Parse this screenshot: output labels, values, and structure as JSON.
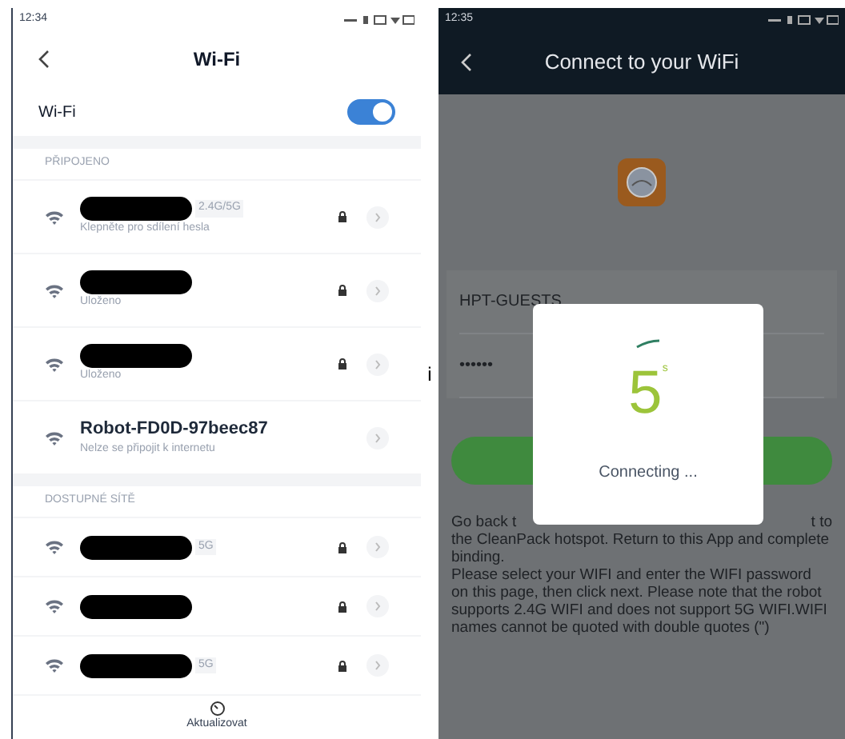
{
  "left_phone": {
    "status_bar": {
      "time": "12:34"
    },
    "title": "Wi-Fi",
    "wifi_toggle": {
      "label": "Wi-Fi",
      "on": true
    },
    "sections": [
      {
        "label": "PŘIPOJENO",
        "networks": [
          {
            "tag": "2.4G/5G",
            "subtitle": "Klepněte pro sdílení hesla",
            "redacted": true,
            "locked": true
          },
          {
            "subtitle": "Uloženo",
            "redacted": true,
            "locked": true
          },
          {
            "subtitle": "Uloženo",
            "redacted": true,
            "locked": true
          },
          {
            "name": "Robot-FD0D-97beec87",
            "subtitle": "Nelze se připojit k internetu",
            "redacted": false,
            "locked": false
          }
        ]
      },
      {
        "label": "DOSTUPNÉ SÍTĚ",
        "networks": [
          {
            "tag": "5G",
            "redacted": true,
            "locked": true
          },
          {
            "redacted": true,
            "locked": true
          },
          {
            "tag": "5G",
            "redacted": true,
            "locked": true
          }
        ]
      }
    ],
    "refresh_label": "Aktualizovat"
  },
  "separator_glyph": "i",
  "right_phone": {
    "status_bar": {
      "time": "12:35"
    },
    "title": "Connect to your WiFi",
    "fields": [
      {
        "value": "HPT-GUESTS"
      },
      {
        "value": "••••••"
      }
    ],
    "instructions": {
      "first_line_left": "Go back t",
      "first_line_right": "t to",
      "continued": "the CleanPack hotspot. Return to this App and complete binding.",
      "note": "Please select your WIFI and enter the WIFI password on this page, then click next. Please note that the robot supports 2.4G WIFI and does not support 5G WIFI.WIFI names cannot be quoted with double quotes (\")"
    },
    "dialog": {
      "countdown": "5",
      "unit": "s",
      "message": "Connecting ..."
    }
  }
}
